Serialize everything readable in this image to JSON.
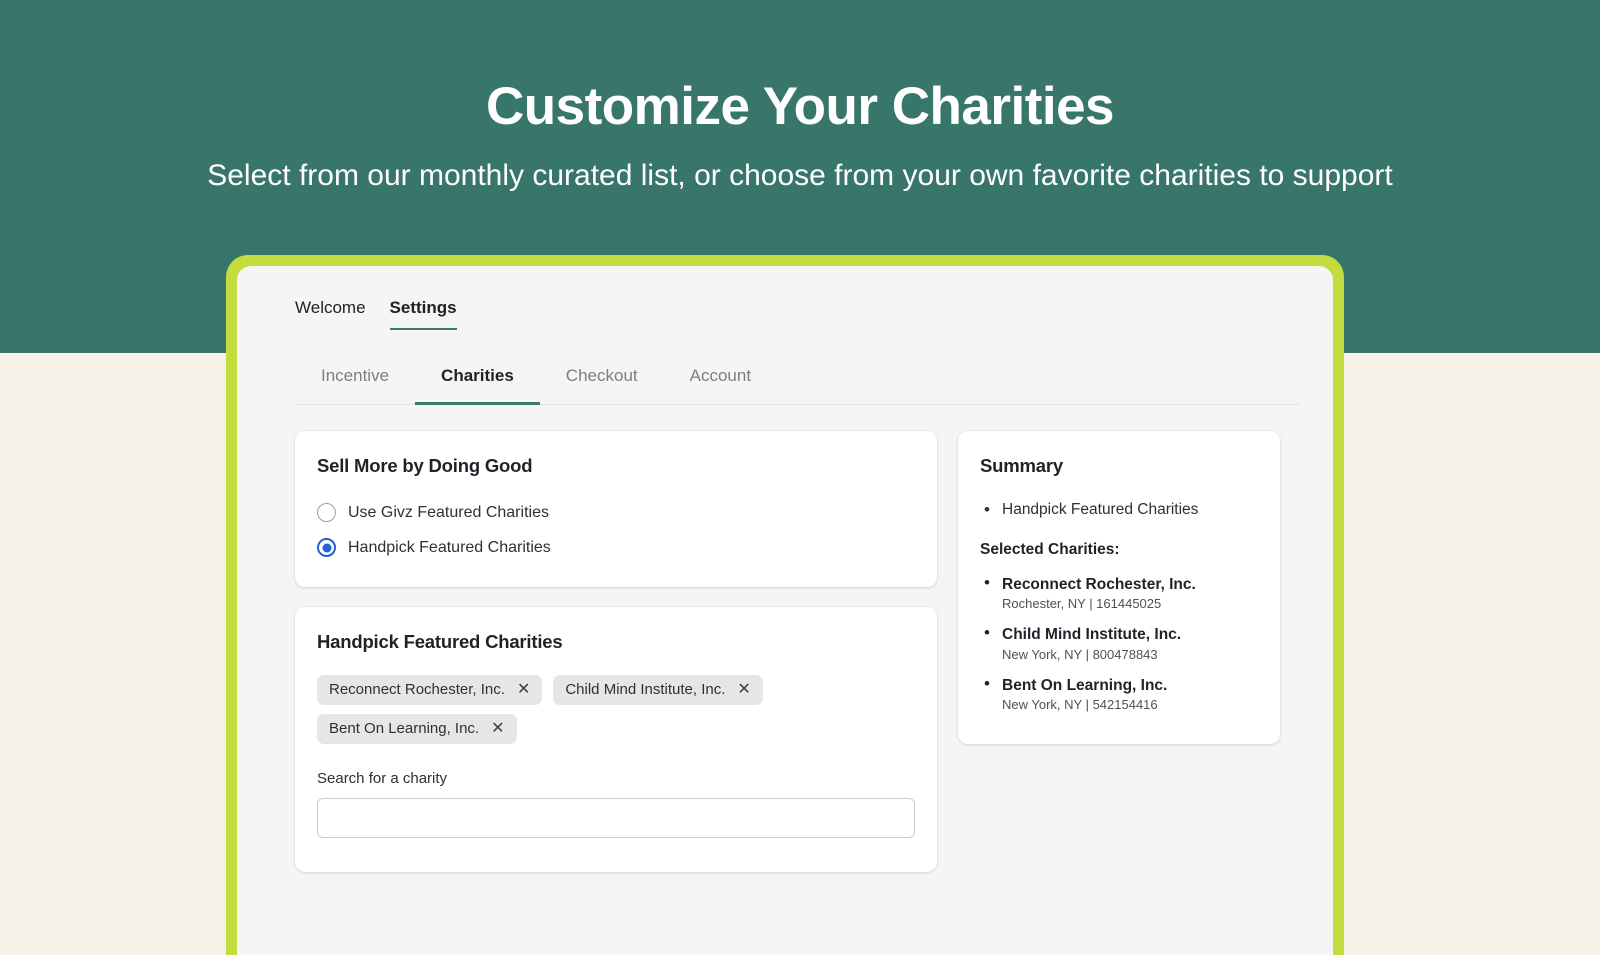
{
  "hero": {
    "title": "Customize Your Charities",
    "subtitle": "Select from our monthly curated list, or choose from your own favorite charities to support",
    "bg_color": "#38756a",
    "page_bg_color": "#f7f2e7"
  },
  "frame": {
    "border_color": "#c5dc3f",
    "window_bg": "#f5f5f5"
  },
  "topnav": {
    "items": [
      {
        "label": "Welcome",
        "active": false
      },
      {
        "label": "Settings",
        "active": true
      }
    ],
    "active_underline_color": "#3d7a6c"
  },
  "tabs": {
    "items": [
      {
        "label": "Incentive",
        "active": false
      },
      {
        "label": "Charities",
        "active": true
      },
      {
        "label": "Checkout",
        "active": false
      },
      {
        "label": "Account",
        "active": false
      }
    ],
    "active_underline_color": "#3d7a6c"
  },
  "sell_more_card": {
    "title": "Sell More by Doing Good",
    "options": [
      {
        "label": "Use Givz Featured Charities",
        "selected": false
      },
      {
        "label": "Handpick Featured Charities",
        "selected": true
      }
    ],
    "selected_color": "#2060d8"
  },
  "handpick_card": {
    "title": "Handpick Featured Charities",
    "chips": [
      {
        "label": "Reconnect Rochester, Inc.",
        "remove_icon": "close-icon"
      },
      {
        "label": "Child Mind Institute, Inc.",
        "remove_icon": "close-icon"
      },
      {
        "label": "Bent On Learning, Inc.",
        "remove_icon": "close-icon"
      }
    ],
    "search_label": "Search for a charity",
    "search_value": "",
    "search_placeholder": ""
  },
  "summary_card": {
    "title": "Summary",
    "bullets": [
      "Handpick Featured Charities"
    ],
    "selected_heading": "Selected Charities:",
    "charities": [
      {
        "name": "Reconnect Rochester, Inc.",
        "meta": "Rochester, NY | 161445025"
      },
      {
        "name": "Child Mind Institute, Inc.",
        "meta": "New York, NY | 800478843"
      },
      {
        "name": "Bent On Learning, Inc.",
        "meta": "New York, NY | 542154416"
      }
    ]
  }
}
